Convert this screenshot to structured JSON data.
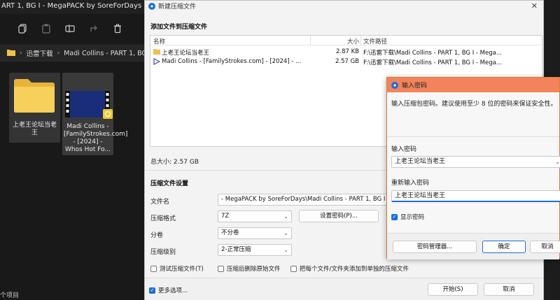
{
  "explorer": {
    "title": "ART 1, BG I - MegaPACK by SoreForDays",
    "breadcrumb": [
      "迅雷下载",
      "Madi Collins - PART 1, BG I -"
    ],
    "items": [
      {
        "label": "上老王论坛当老王",
        "type": "folder"
      },
      {
        "label": "Madi Collins - [FamilyStrokes.com] - [2024] - Whos Hot Fo...",
        "type": "video"
      }
    ],
    "status": "个项目"
  },
  "dialog": {
    "title": "新建压缩文件",
    "add_section": "添加文件到压缩文件",
    "columns": {
      "name": "名称",
      "size": "大小",
      "path": "文件路径"
    },
    "files": [
      {
        "name": "上老王论坛当老王",
        "size": "2.87 KB",
        "path": "F:\\迅雷下载\\Madi Collins - PART 1, BG I - Mega..."
      },
      {
        "name": "Madi Collins - [FamilyStrokes.com] - [2024] - ...",
        "size": "2.57 GB",
        "path": "F:\\迅雷下载\\Madi Collins - PART 1, BG I - Mega..."
      }
    ],
    "total": "总大小: 2.57 GB",
    "settings_section": "压缩文件设置",
    "filename_label": "文件名",
    "filename_value": "- MegaPACK by SoreForDays\\Madi Collins - PART 1, BG I",
    "format_label": "压缩格式",
    "format_value": "7Z",
    "set_password_btn": "设置密码(P)...",
    "split_label": "分卷",
    "split_value": "不分卷",
    "level_label": "压缩级别",
    "level_value": "2-正常压缩",
    "test_chk": "测试压缩文件(T)",
    "delete_chk": "压缩后删除原始文件",
    "separate_chk": "把每个文件/文件夹添加到单独的压缩文件",
    "more_options": "更多选项...",
    "start_btn": "开始(S)",
    "cancel_btn": "取消"
  },
  "password": {
    "title": "输入密码",
    "description": "输入压缩包密码。建议使用至少 8 位的密码来保证安全性。",
    "enter_label": "输入密码",
    "enter_value": "上老王论坛当老王",
    "reenter_label": "重新输入密码",
    "reenter_value": "上老王论坛当老王",
    "show_password": "显示密码",
    "manager_btn": "密码管理器...",
    "ok_btn": "确定",
    "cancel_btn": "取消"
  }
}
